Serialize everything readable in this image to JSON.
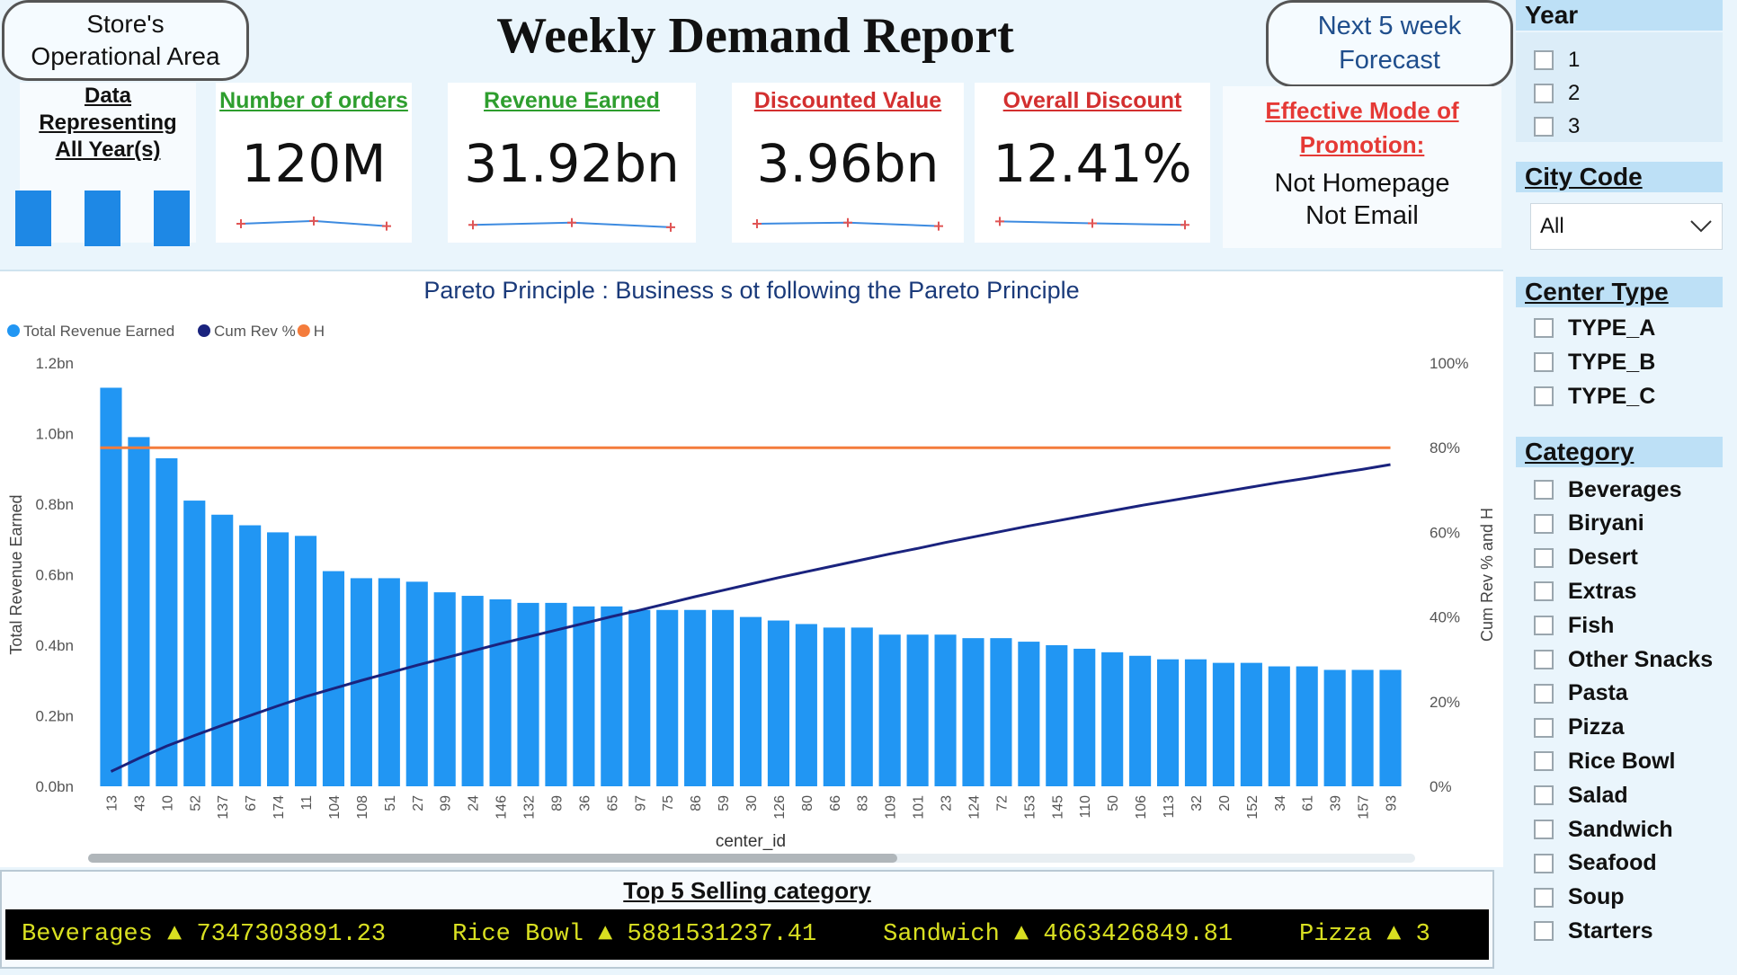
{
  "header": {
    "title": "Weekly Demand Report",
    "nav_left": "Store's\nOperational Area",
    "nav_right": "Next 5 week\nForecast"
  },
  "data_rep": {
    "text": "Data\nRepresenting\nAll Year(s)",
    "bars": [
      1,
      1,
      1
    ]
  },
  "kpis": [
    {
      "label": "Number of orders",
      "value": "120M",
      "color": "#2e9e2e",
      "trend": [
        0.5,
        0.62,
        0.4
      ]
    },
    {
      "label": "Revenue Earned",
      "value": "31.92bn",
      "color": "#2e9e2e",
      "trend": [
        0.45,
        0.55,
        0.35
      ]
    },
    {
      "label": "Discounted Value",
      "value": "3.96bn",
      "color": "#d32f2f",
      "trend": [
        0.5,
        0.55,
        0.4
      ]
    },
    {
      "label": "Overall Discount",
      "value": "12.41%",
      "color": "#d32f2f",
      "trend": [
        0.6,
        0.52,
        0.45
      ]
    }
  ],
  "promo": {
    "label": "Effective Mode of\nPromotion:",
    "value": "Not Homepage\nNot Email"
  },
  "chart_data": {
    "type": "bar",
    "title": "Pareto Principle : Business s ot following the Pareto Principle",
    "legend": [
      {
        "name": "Total Revenue Earned",
        "color": "#2196f3"
      },
      {
        "name": "Cum Rev %",
        "color": "#1a237e"
      },
      {
        "name": "H",
        "color": "#f47c3c"
      }
    ],
    "legend_position": "top-left",
    "xlabel": "center_id",
    "ylabel": "Total Revenue Earned",
    "y2label": "Cum Rev % and H",
    "ylim": [
      0,
      1.2
    ],
    "y_ticks": [
      "0.0bn",
      "0.2bn",
      "0.4bn",
      "0.6bn",
      "0.8bn",
      "1.0bn",
      "1.2bn"
    ],
    "y2lim": [
      0,
      100
    ],
    "y2_ticks": [
      "0%",
      "20%",
      "40%",
      "60%",
      "80%",
      "100%"
    ],
    "categories": [
      "13",
      "43",
      "10",
      "52",
      "137",
      "67",
      "174",
      "11",
      "104",
      "108",
      "51",
      "27",
      "99",
      "24",
      "146",
      "132",
      "89",
      "36",
      "65",
      "97",
      "75",
      "86",
      "59",
      "30",
      "126",
      "80",
      "66",
      "83",
      "109",
      "101",
      "23",
      "124",
      "72",
      "153",
      "145",
      "110",
      "50",
      "106",
      "113",
      "32",
      "20",
      "152",
      "34",
      "61",
      "39",
      "157",
      "93"
    ],
    "series": [
      {
        "name": "Total Revenue Earned",
        "values": [
          1.13,
          0.99,
          0.93,
          0.81,
          0.77,
          0.74,
          0.72,
          0.71,
          0.61,
          0.59,
          0.59,
          0.58,
          0.55,
          0.54,
          0.53,
          0.52,
          0.52,
          0.51,
          0.51,
          0.5,
          0.5,
          0.5,
          0.5,
          0.48,
          0.47,
          0.46,
          0.45,
          0.45,
          0.43,
          0.43,
          0.43,
          0.42,
          0.42,
          0.41,
          0.4,
          0.39,
          0.38,
          0.37,
          0.36,
          0.36,
          0.35,
          0.35,
          0.34,
          0.34,
          0.33,
          0.33,
          0.33
        ]
      },
      {
        "name": "Cum Rev %",
        "values": [
          3.5,
          6.6,
          9.5,
          12.0,
          14.4,
          16.7,
          19.0,
          21.2,
          23.1,
          25.0,
          26.8,
          28.6,
          30.3,
          32.0,
          33.7,
          35.3,
          36.9,
          38.5,
          40.1,
          41.6,
          43.2,
          44.8,
          46.3,
          47.8,
          49.3,
          50.7,
          52.1,
          53.5,
          54.9,
          56.2,
          57.6,
          58.9,
          60.2,
          61.5,
          62.7,
          63.9,
          65.1,
          66.3,
          67.4,
          68.5,
          69.6,
          70.7,
          71.8,
          72.8,
          73.9,
          74.9,
          76.0
        ]
      },
      {
        "name": "H",
        "values": [
          80
        ]
      }
    ],
    "grid": false
  },
  "top5": {
    "title": "Top 5 Selling category",
    "items": [
      {
        "name": "Beverages",
        "arrow": "▲",
        "value": "7347303891.23"
      },
      {
        "name": "Rice Bowl",
        "arrow": "▲",
        "value": "5881531237.41"
      },
      {
        "name": "Sandwich",
        "arrow": "▲",
        "value": "4663426849.81"
      },
      {
        "name": "Pizza",
        "arrow": "▲",
        "value": "3"
      }
    ]
  },
  "slicers": {
    "year": {
      "title": "Year",
      "items": [
        "1",
        "2",
        "3"
      ]
    },
    "city": {
      "title": "City Code",
      "selected": "All",
      "icon": "chevron-down-icon"
    },
    "center_type": {
      "title": "Center Type",
      "items": [
        "TYPE_A",
        "TYPE_B",
        "TYPE_C"
      ]
    },
    "category": {
      "title": "Category",
      "items": [
        "Beverages",
        "Biryani",
        "Desert",
        "Extras",
        "Fish",
        "Other Snacks",
        "Pasta",
        "Pizza",
        "Rice Bowl",
        "Salad",
        "Sandwich",
        "Seafood",
        "Soup",
        "Starters"
      ]
    }
  }
}
